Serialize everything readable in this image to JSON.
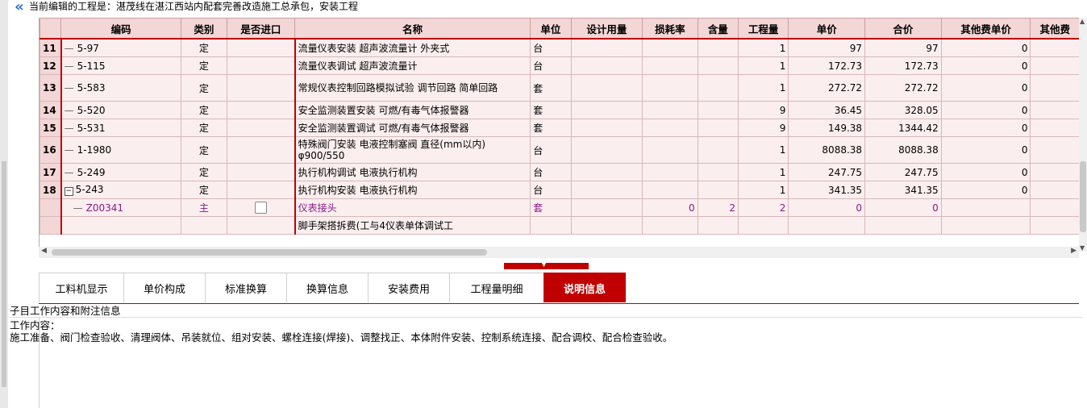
{
  "header": {
    "collapse_icon": "double-chevron-left-icon",
    "title": "当前编辑的工程是：湛茂线在湛江西站内配套完善改造施工总承包，安装工程"
  },
  "grid": {
    "columns": [
      "编码",
      "类别",
      "是否进口",
      "名称",
      "单位",
      "设计用量",
      "损耗率",
      "含量",
      "工程量",
      "单价",
      "合价",
      "其他费单价",
      "其他费"
    ],
    "rows": [
      {
        "rn": "11",
        "code": "5-97",
        "type": "定",
        "name": "流量仪表安装 超声波流量计 外夹式",
        "unit": "台",
        "design": "",
        "loss": "",
        "content": "",
        "qty": "1",
        "price": "97",
        "total": "97",
        "other_price": "0",
        "tall": false
      },
      {
        "rn": "12",
        "code": "5-115",
        "type": "定",
        "name": "流量仪表调试 超声波流量计",
        "unit": "台",
        "design": "",
        "loss": "",
        "content": "",
        "qty": "1",
        "price": "172.73",
        "total": "172.73",
        "other_price": "0",
        "tall": false
      },
      {
        "rn": "13",
        "code": "5-583",
        "type": "定",
        "name": "常规仪表控制回路模拟试验 调节回路 简单回路",
        "unit": "套",
        "design": "",
        "loss": "",
        "content": "",
        "qty": "1",
        "price": "272.72",
        "total": "272.72",
        "other_price": "0",
        "tall": true
      },
      {
        "rn": "14",
        "code": "5-520",
        "type": "定",
        "name": "安全监测装置安装 可燃/有毒气体报警器",
        "unit": "套",
        "design": "",
        "loss": "",
        "content": "",
        "qty": "9",
        "price": "36.45",
        "total": "328.05",
        "other_price": "0",
        "tall": false
      },
      {
        "rn": "15",
        "code": "5-531",
        "type": "定",
        "name": "安全监测装置调试 可燃/有毒气体报警器",
        "unit": "套",
        "design": "",
        "loss": "",
        "content": "",
        "qty": "9",
        "price": "149.38",
        "total": "1344.42",
        "other_price": "0",
        "tall": false
      },
      {
        "rn": "16",
        "code": "1-1980",
        "type": "定",
        "name": "特殊阀门安装 电液控制塞阀 直径(mm以内) φ900/550",
        "unit": "台",
        "design": "",
        "loss": "",
        "content": "",
        "qty": "1",
        "price": "8088.38",
        "total": "8088.38",
        "other_price": "0",
        "tall": true
      },
      {
        "rn": "17",
        "code": "5-249",
        "type": "定",
        "name": "执行机构调试 电液执行机构",
        "unit": "台",
        "design": "",
        "loss": "",
        "content": "",
        "qty": "1",
        "price": "247.75",
        "total": "247.75",
        "other_price": "0",
        "tall": false
      },
      {
        "rn": "18",
        "code": "5-243",
        "type": "定",
        "name": "执行机构安装 电液执行机构",
        "unit": "台",
        "design": "",
        "loss": "",
        "content": "",
        "qty": "1",
        "price": "341.35",
        "total": "341.35",
        "other_price": "0",
        "tall": false
      }
    ],
    "sub_row": {
      "rn": "",
      "code": "Z00341",
      "type": "主",
      "name": "仪表接头",
      "unit": "套",
      "design": "",
      "loss": "0",
      "content": "2",
      "qty": "2",
      "price": "0",
      "total": "0",
      "other_price": ""
    },
    "partial_row_text": "脚手架搭拆费(工与4仪表单体调试工"
  },
  "tabs": [
    "工料机显示",
    "单价构成",
    "标准换算",
    "换算信息",
    "安装费用",
    "工程量明细",
    "说明信息"
  ],
  "active_tab": "说明信息",
  "description": {
    "heading": "子目工作内容和附注信息",
    "label": "工作内容：",
    "content": "施工准备、阀门检查验收、清理阀体、吊装就位、组对安装、螺栓连接(焊接)、调整找正、本体附件安装、控制系统连接、配合调校、配合检查验收。"
  },
  "colors": {
    "accent": "#c00000",
    "header_bg": "#f3d6d6",
    "row_bg": "#fbeeee",
    "sub_text": "#8a1a8a"
  }
}
